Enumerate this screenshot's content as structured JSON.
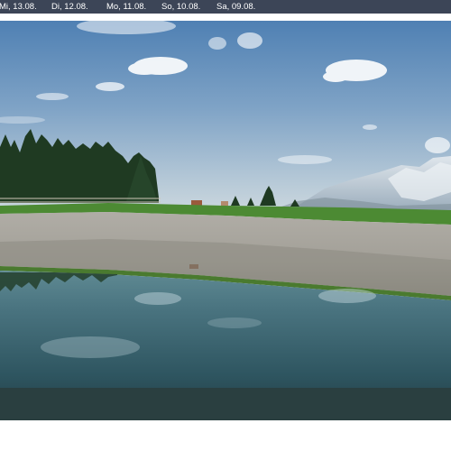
{
  "date_bar": {
    "tabs": [
      {
        "label": "Mi, 13.08."
      },
      {
        "label": "Di, 12.08."
      },
      {
        "label": "Mo, 11.08."
      },
      {
        "label": "So, 10.08."
      },
      {
        "label": "Sa, 09.08."
      }
    ]
  },
  "colors": {
    "date_bar_bg": "#3c4557",
    "date_text": "#ffffff",
    "sky_top": "#5d8ab8",
    "sky_bottom": "#c9d6df",
    "grass": "#4f8a35",
    "gravel": "#a8a59e",
    "water": "#2f5057"
  }
}
